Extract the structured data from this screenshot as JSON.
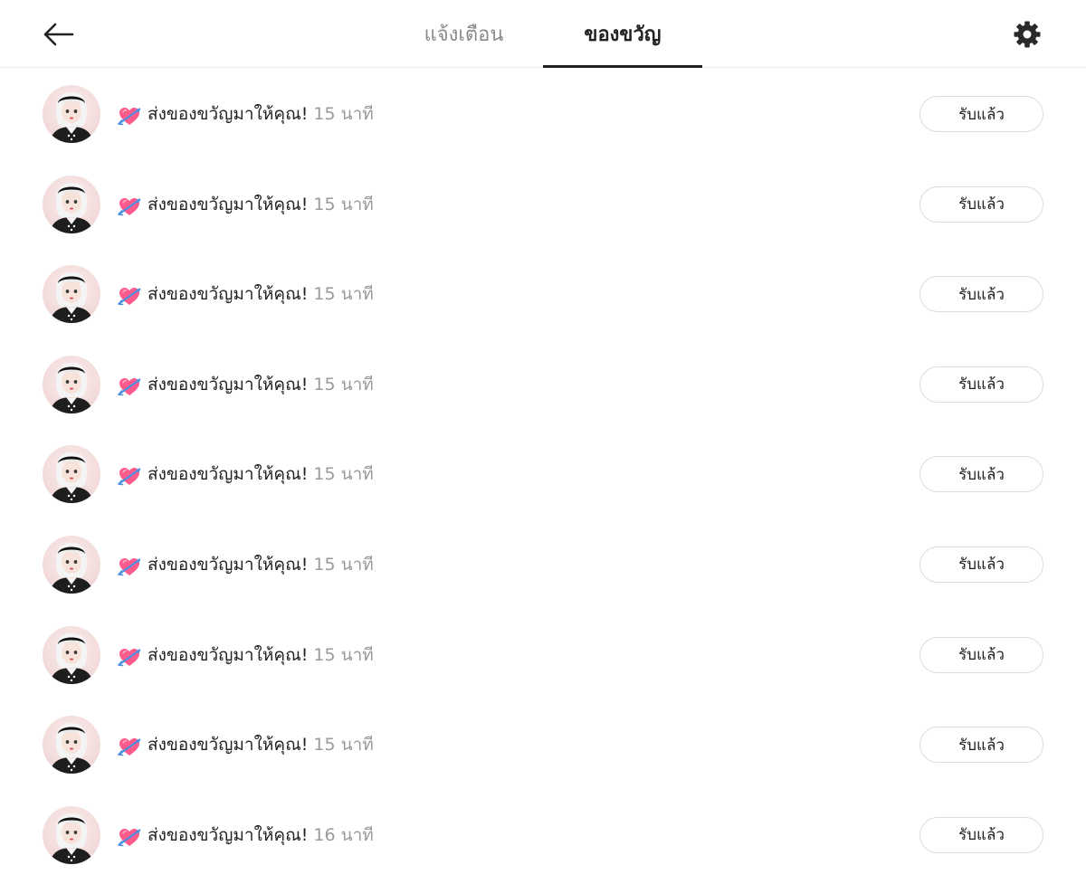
{
  "header": {
    "back_icon": "arrow-left-icon",
    "settings_icon": "gear-icon",
    "tabs": [
      {
        "label": "แจ้งเตือน",
        "active": false
      },
      {
        "label": "ของขวัญ",
        "active": true
      }
    ]
  },
  "colors": {
    "active_tab": "#222222",
    "inactive_tab": "#8a8a8a",
    "time_text": "#9a9a9a",
    "button_border": "#dcdcdc",
    "heart": "#ff5a8c",
    "arrow": "#4a90e2"
  },
  "gifts": [
    {
      "icon": "heart-with-arrow-icon",
      "message": "ส่งของขวัญมาให้คุณ!",
      "time": "15 นาที",
      "button": "รับแล้ว"
    },
    {
      "icon": "heart-with-arrow-icon",
      "message": "ส่งของขวัญมาให้คุณ!",
      "time": "15 นาที",
      "button": "รับแล้ว"
    },
    {
      "icon": "heart-with-arrow-icon",
      "message": "ส่งของขวัญมาให้คุณ!",
      "time": "15 นาที",
      "button": "รับแล้ว"
    },
    {
      "icon": "heart-with-arrow-icon",
      "message": "ส่งของขวัญมาให้คุณ!",
      "time": "15 นาที",
      "button": "รับแล้ว"
    },
    {
      "icon": "heart-with-arrow-icon",
      "message": "ส่งของขวัญมาให้คุณ!",
      "time": "15 นาที",
      "button": "รับแล้ว"
    },
    {
      "icon": "heart-with-arrow-icon",
      "message": "ส่งของขวัญมาให้คุณ!",
      "time": "15 นาที",
      "button": "รับแล้ว"
    },
    {
      "icon": "heart-with-arrow-icon",
      "message": "ส่งของขวัญมาให้คุณ!",
      "time": "15 นาที",
      "button": "รับแล้ว"
    },
    {
      "icon": "heart-with-arrow-icon",
      "message": "ส่งของขวัญมาให้คุณ!",
      "time": "15 นาที",
      "button": "รับแล้ว"
    },
    {
      "icon": "heart-with-arrow-icon",
      "message": "ส่งของขวัญมาให้คุณ!",
      "time": "16 นาที",
      "button": "รับแล้ว"
    }
  ]
}
